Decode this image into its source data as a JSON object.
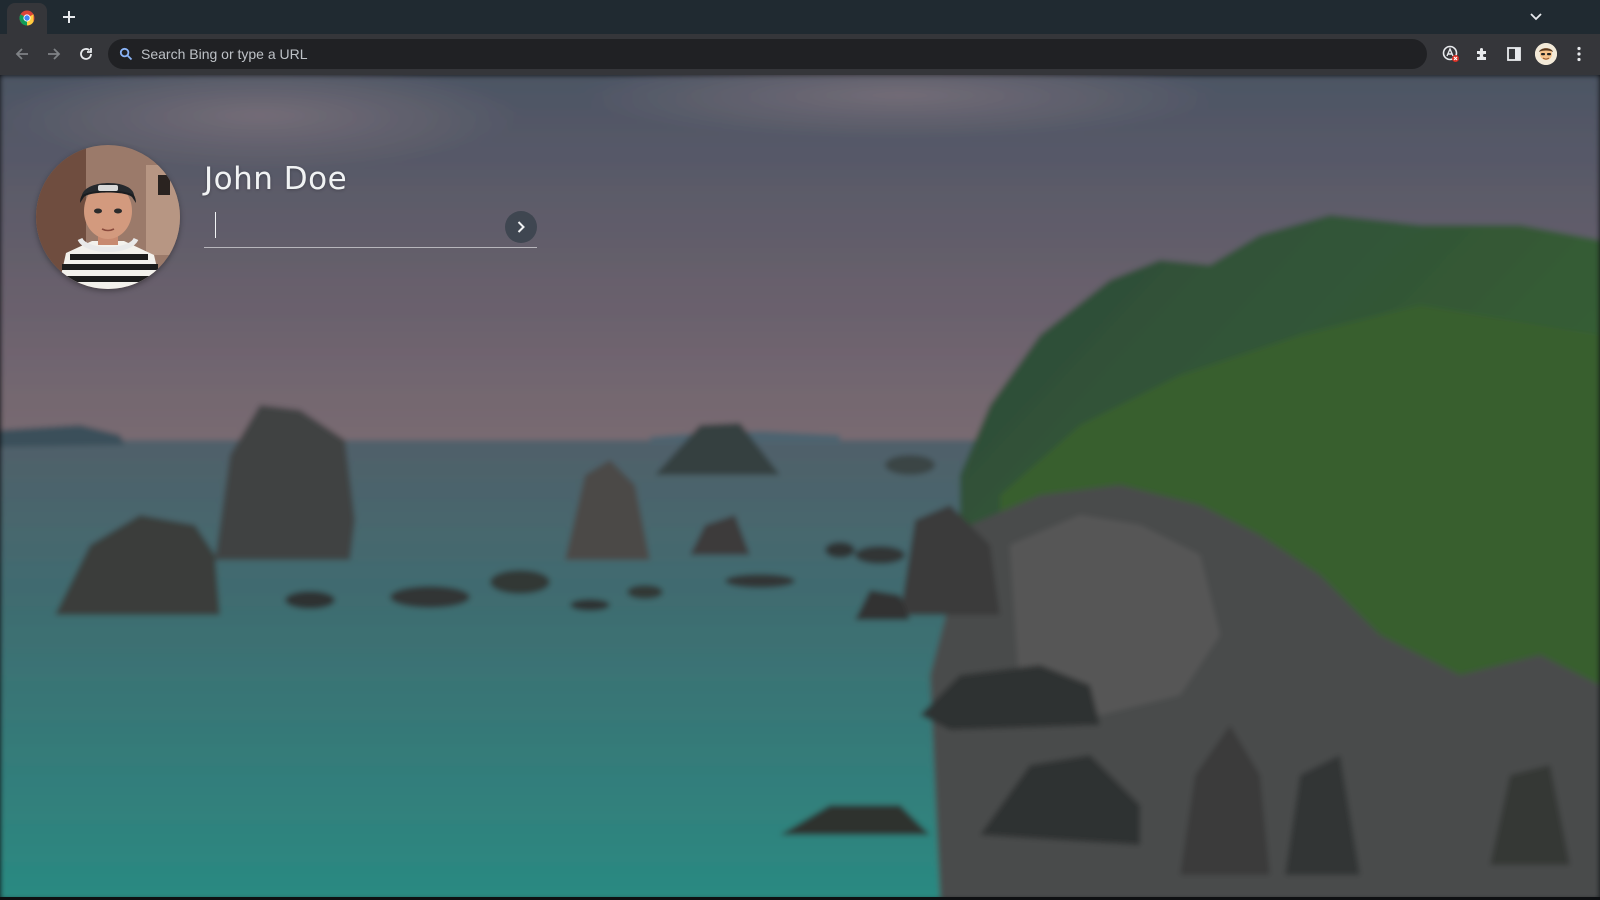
{
  "browser": {
    "tab": {
      "favicon": "chrome-icon"
    },
    "new_tab_icon": "plus-icon",
    "tab_search_icon": "chevron-down-icon",
    "nav": {
      "back_icon": "back-arrow-icon",
      "forward_icon": "forward-arrow-icon",
      "reload_icon": "reload-icon"
    },
    "omnibox": {
      "placeholder": "Search Bing or type a URL",
      "value": "",
      "icon": "search-icon"
    },
    "extensions": [
      "translate-extension-icon",
      "extensions-puzzle-icon",
      "side-panel-icon"
    ],
    "profile_icon": "profile-avatar",
    "menu_icon": "kebab-menu-icon"
  },
  "lock_screen": {
    "user": {
      "name": "John Doe",
      "avatar": "user-avatar"
    },
    "password": {
      "value": "",
      "placeholder": ""
    },
    "submit_icon": "chevron-right-icon"
  },
  "colors": {
    "tabstrip": "#202a31",
    "toolbar": "#35363a",
    "omnibox": "#202124",
    "accent_blue": "#8ab4f8",
    "text_light": "#f1f3f4"
  }
}
